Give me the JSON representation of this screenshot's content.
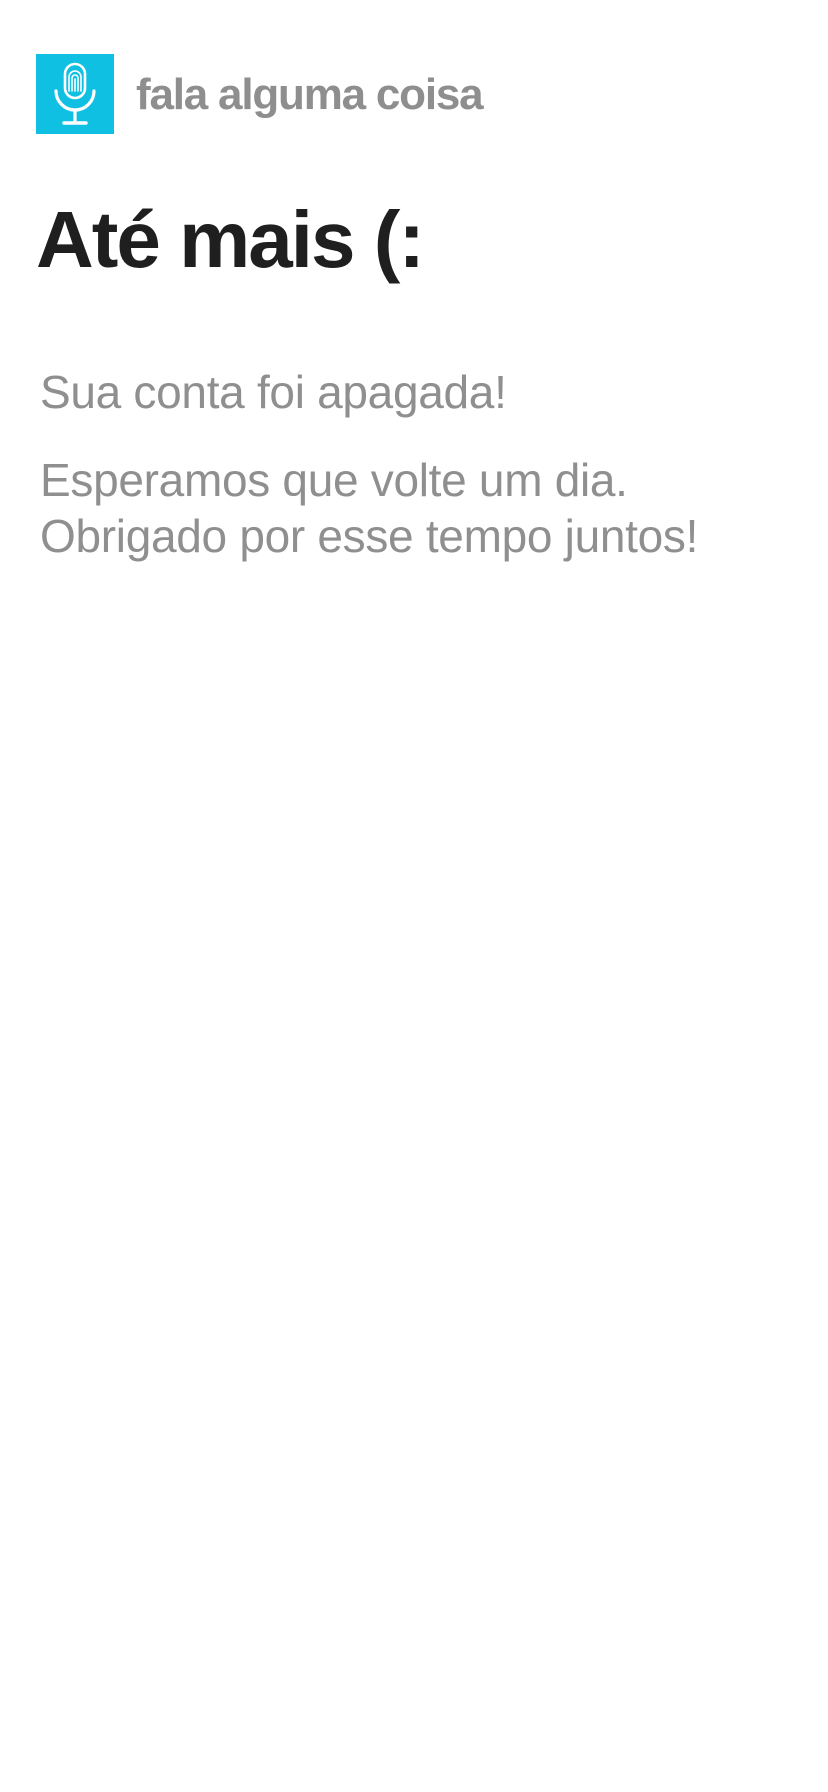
{
  "app": {
    "logo_icon": "microphone-fingerprint-icon",
    "name": "fala alguma coisa",
    "accent_color": "#0fc0e3"
  },
  "page": {
    "title": "Até mais (:",
    "message_deleted": "Sua conta foi apagada!",
    "message_hope": "Esperamos que volte um dia.",
    "message_thanks": "Obrigado por esse tempo juntos!"
  }
}
